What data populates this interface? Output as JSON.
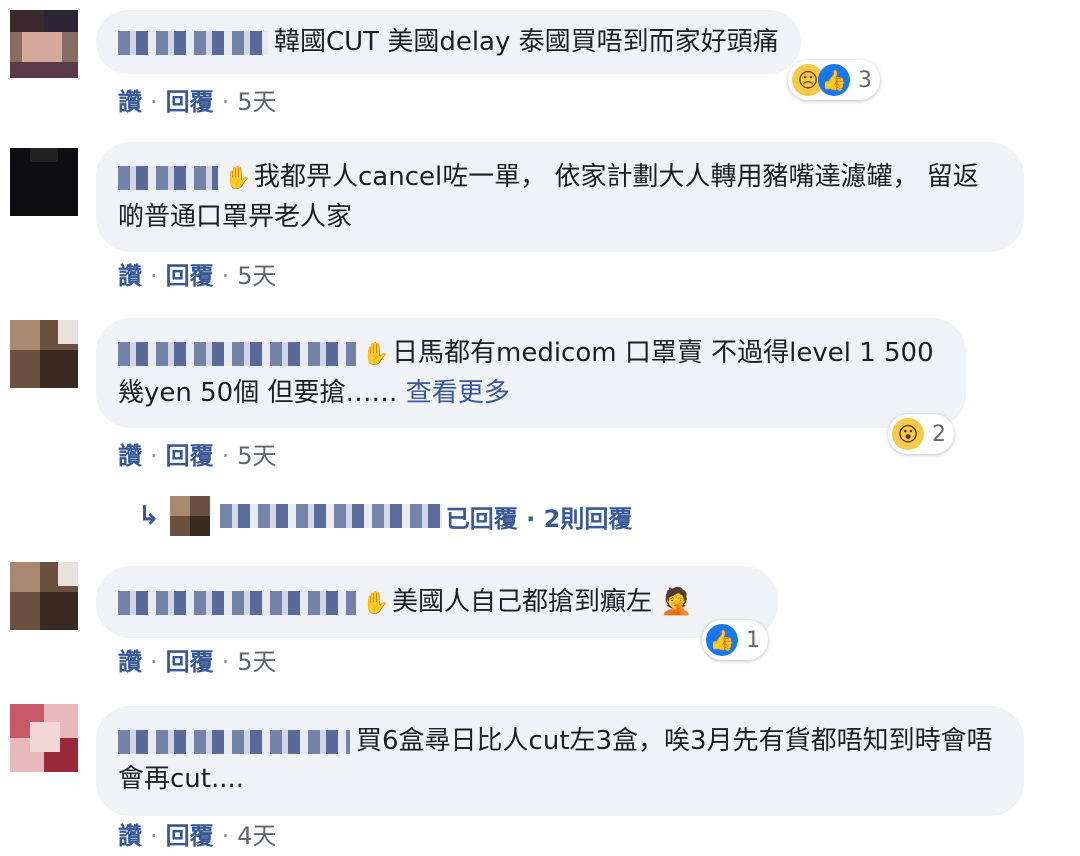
{
  "actions": {
    "like": "讚",
    "reply": "回覆",
    "sep": "·"
  },
  "comments": [
    {
      "text": "韓國CUT 美國delay 泰國買唔到而家好頭痛",
      "time": "5天",
      "reactions": {
        "icons": [
          "sad-icon",
          "like-icon"
        ],
        "count": "3"
      }
    },
    {
      "text": "我都畀人cancel咗一單， 依家計劃大人轉用豬嘴達濾罐， 留返啲普通口罩畀老人家",
      "time": "5天"
    },
    {
      "text": "日馬都有medicom 口罩賣 不過得level 1 500幾yen 50個 但要搶……",
      "see_more": "查看更多",
      "time": "5天",
      "reactions": {
        "icons": [
          "wow-icon"
        ],
        "count": "2"
      }
    },
    {
      "text": "美國人自己都搶到癲左 🤦",
      "time": "5天",
      "reactions": {
        "icons": [
          "like-icon"
        ],
        "count": "1"
      }
    },
    {
      "text": "買6盒尋日比人cut左3盒，唉3月先有貨都唔知到時會唔會再cut....",
      "time": "4天"
    }
  ],
  "reply_summary": {
    "label": "已回覆 · 2則回覆"
  }
}
